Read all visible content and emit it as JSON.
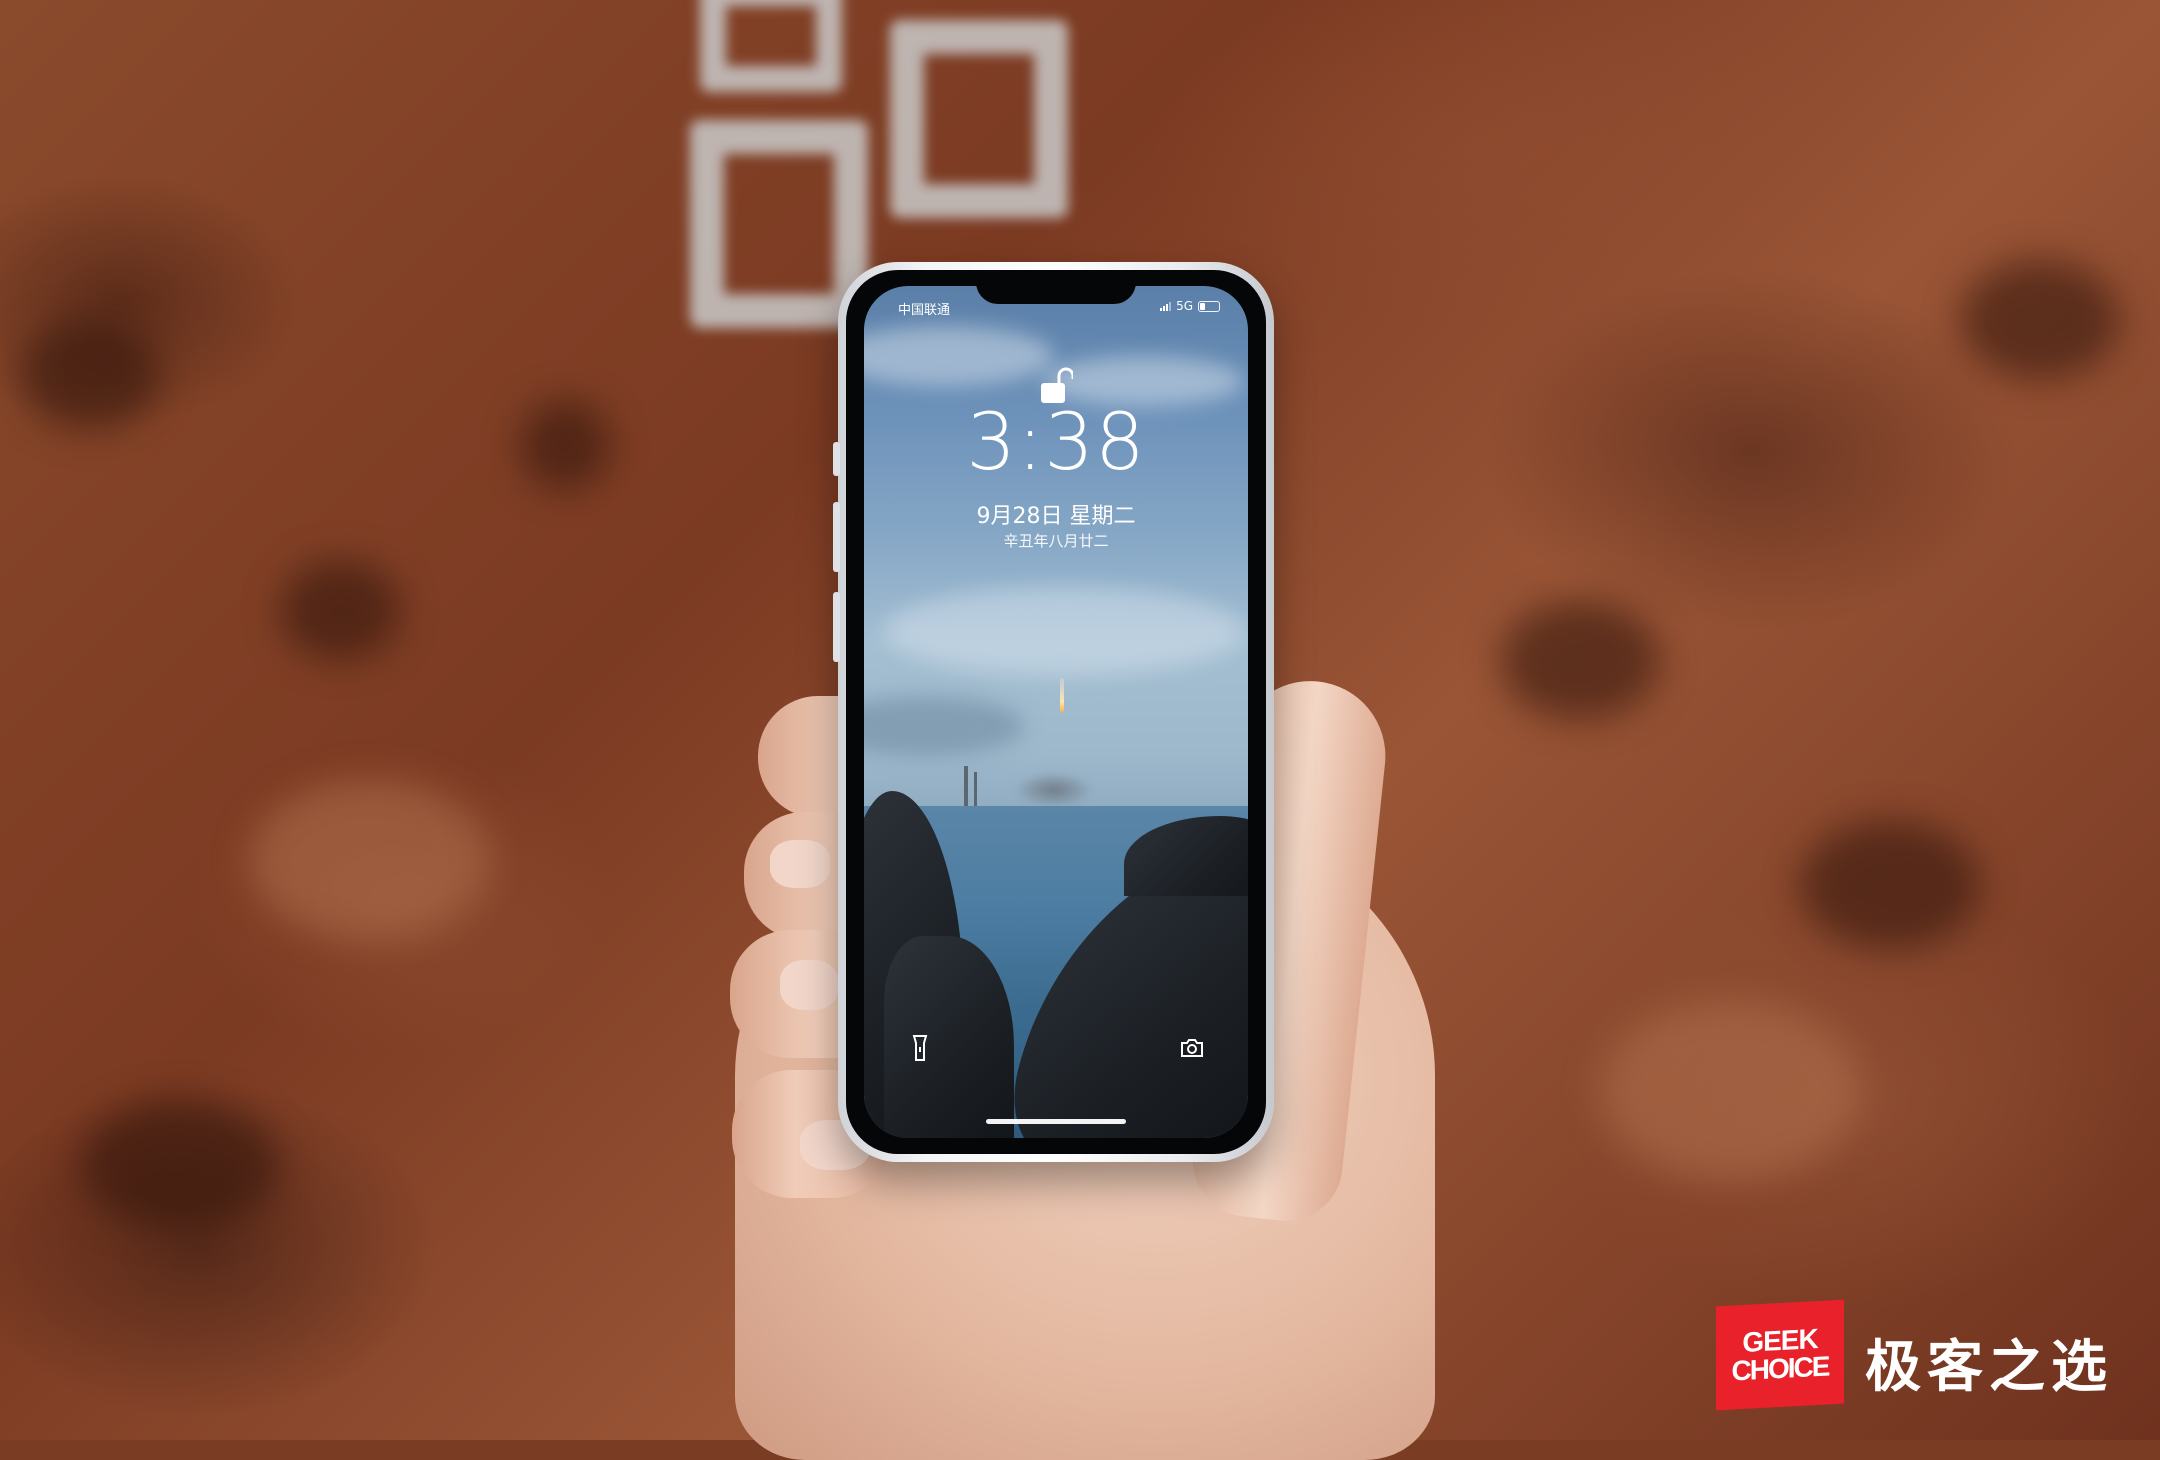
{
  "status_bar": {
    "carrier": "中国联通",
    "network": "5G",
    "icons": [
      "signal-icon",
      "battery-icon"
    ]
  },
  "lock_screen": {
    "lock_state_icon": "unlocked-padlock-icon",
    "time": "3:38",
    "date": "9月28日 星期二",
    "lunar_date": "辛丑年八月廿二",
    "quick_actions": [
      "flashlight-icon",
      "camera-icon"
    ]
  },
  "watermark": {
    "logo_line1": "GEEK",
    "logo_line2": "CHOICE",
    "brand_cn": "极客之选",
    "brand_color": "#e8212a"
  }
}
